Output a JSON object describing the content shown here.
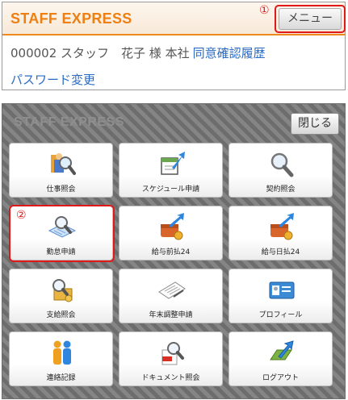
{
  "top": {
    "brand": "STAFF EXPRESS",
    "menu_label": "メニュー",
    "annotation_1": "①",
    "user_text": "000002 スタッフ　花子 様 本社",
    "consent_link": "同意確認履歴",
    "password_link": "パスワード変更"
  },
  "menu": {
    "ghost_brand": "STAFF EXPRESS",
    "close_label": "閉じる",
    "annotation_2": "②",
    "tiles": [
      {
        "label": "仕事照会",
        "icon": "search-person-icon"
      },
      {
        "label": "スケジュール申請",
        "icon": "calendar-arrow-icon"
      },
      {
        "label": "契約照会",
        "icon": "search-icon"
      },
      {
        "label": "勤怠申請",
        "icon": "timesheet-search-icon"
      },
      {
        "label": "給与前払24",
        "icon": "wallet-arrow-icon"
      },
      {
        "label": "給与日払24",
        "icon": "wallet-arrow-icon"
      },
      {
        "label": "支給照会",
        "icon": "money-search-icon"
      },
      {
        "label": "年末調整申請",
        "icon": "document-pen-icon"
      },
      {
        "label": "プロフィール",
        "icon": "id-card-icon"
      },
      {
        "label": "連絡記録",
        "icon": "people-icon"
      },
      {
        "label": "ドキュメント照会",
        "icon": "pdf-search-icon"
      },
      {
        "label": "ログアウト",
        "icon": "logout-arrow-icon"
      }
    ]
  },
  "colors": {
    "brand_orange": "#ee7f12",
    "link_blue": "#2a6bc4",
    "annotation_red": "#e01818"
  }
}
